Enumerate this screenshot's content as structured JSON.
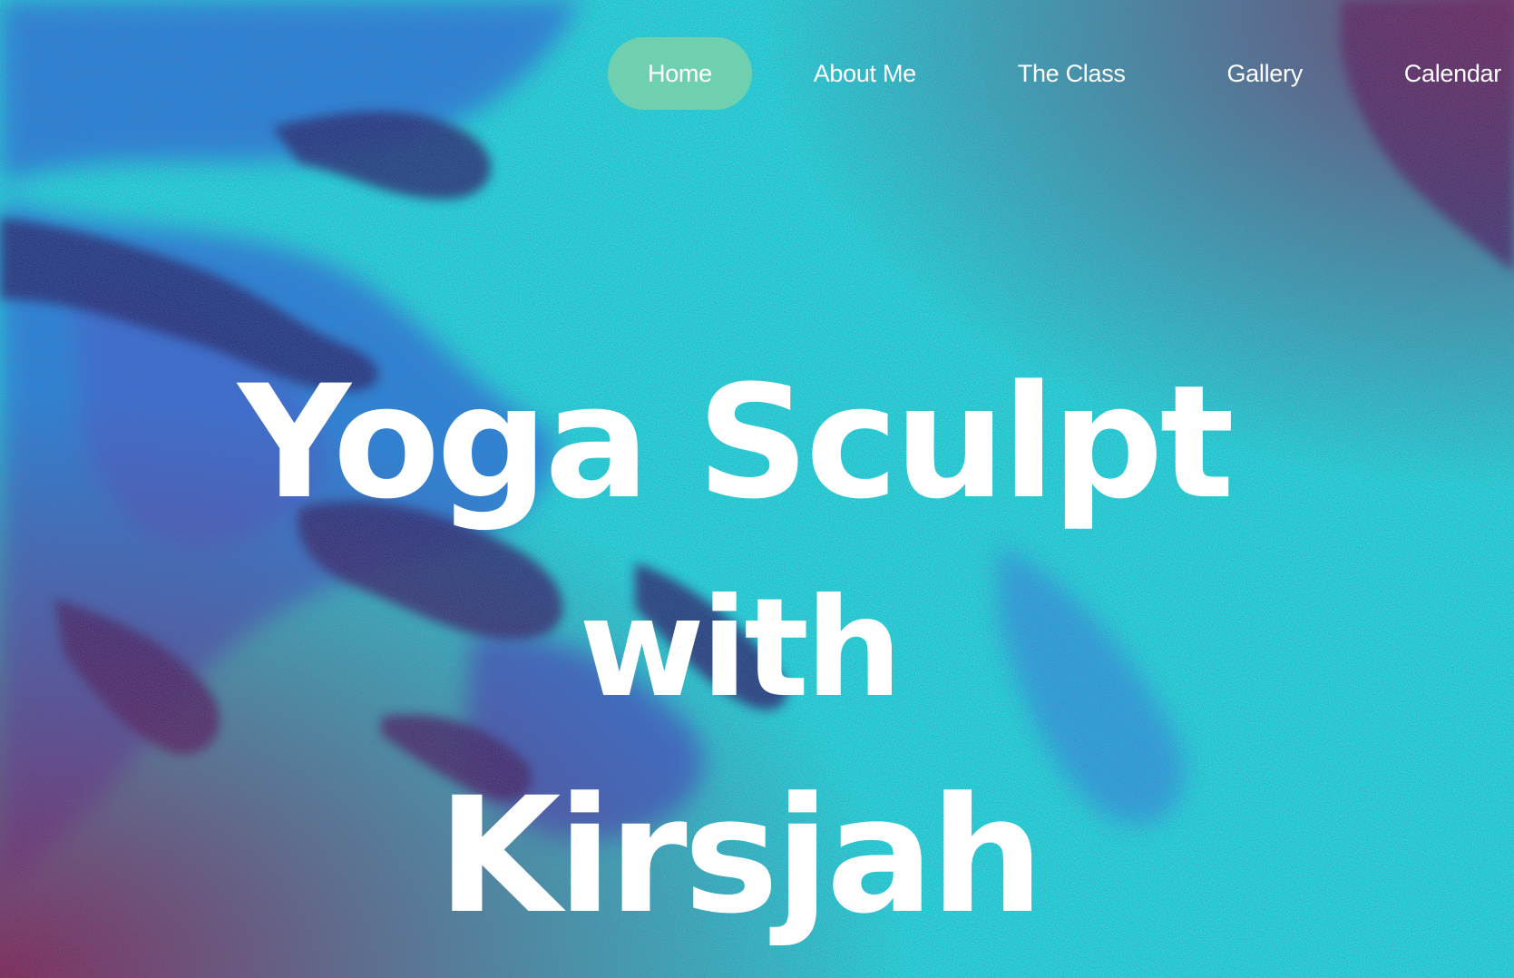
{
  "nav": {
    "items": [
      {
        "label": "Home",
        "active": true
      },
      {
        "label": "About Me",
        "active": false
      },
      {
        "label": "The Class",
        "active": false
      },
      {
        "label": "Gallery",
        "active": false
      },
      {
        "label": "Calendar",
        "active": false
      }
    ]
  },
  "hero": {
    "line1": "Yoga Sculpt",
    "line2": "with",
    "line3": "Kirsjah"
  },
  "colors": {
    "nav_active_bg": "#6fd0b0",
    "text": "#ffffff",
    "bg_primary": "#22d6d8",
    "bg_blue": "#2a7fd6",
    "bg_dark": "#2a2f6e",
    "bg_red": "#8a1f4f"
  }
}
